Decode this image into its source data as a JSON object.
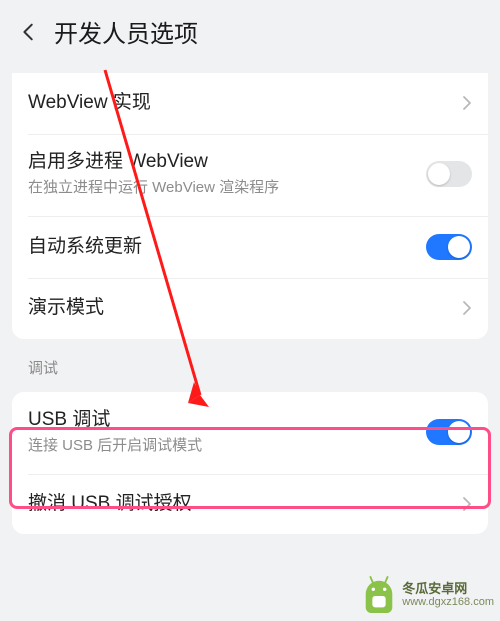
{
  "header": {
    "title": "开发人员选项"
  },
  "group1": [
    {
      "title": "WebView 实现",
      "type": "link"
    },
    {
      "title": "启用多进程 WebView",
      "sub": "在独立进程中运行 WebView 渲染程序",
      "type": "toggle",
      "on": false
    },
    {
      "title": "自动系统更新",
      "type": "toggle",
      "on": true
    },
    {
      "title": "演示模式",
      "type": "link"
    }
  ],
  "sectionLabel": "调试",
  "group2": [
    {
      "title": "USB 调试",
      "sub": "连接 USB 后开启调试模式",
      "type": "toggle",
      "on": true
    },
    {
      "title": "撤消 USB 调试授权",
      "type": "link"
    }
  ],
  "watermark": {
    "name": "冬瓜安卓网",
    "url": "www.dgxz168.com"
  }
}
